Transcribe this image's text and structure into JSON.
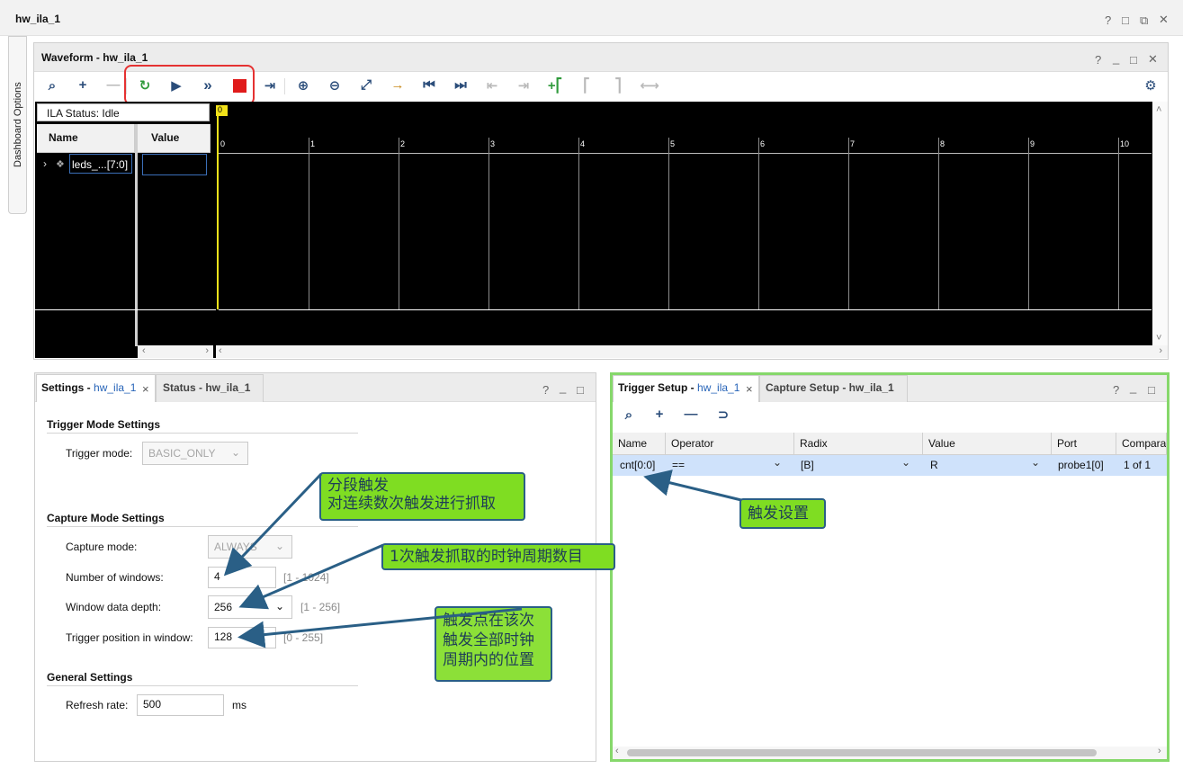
{
  "window": {
    "title": "hw_ila_1",
    "controls": [
      "?",
      "□",
      "⧉",
      "✕"
    ]
  },
  "sidebar": {
    "label": "Dashboard Options"
  },
  "waveform": {
    "title": "Waveform - hw_ila_1",
    "controls": [
      "?",
      "_",
      "□",
      "✕"
    ],
    "status": "ILA Status: Idle",
    "col_name": "Name",
    "col_value": "Value",
    "signal": "leds_...[7:0]",
    "cursor_label": "0",
    "ticks": [
      "0",
      "1",
      "2",
      "3",
      "4",
      "5",
      "6",
      "7",
      "8",
      "9",
      "10"
    ],
    "toolbar": [
      "search-icon",
      "add-icon",
      "remove-icon",
      "run-trigger-immediate-icon",
      "run-trigger-icon",
      "auto-rearm-icon",
      "stop-icon",
      "export-icon",
      "zoom-in-icon",
      "zoom-out-icon",
      "zoom-fit-icon",
      "go-to-cursor-icon",
      "go-to-start-icon",
      "go-to-end-icon",
      "prev-transition-icon",
      "next-transition-icon",
      "add-marker-icon",
      "prev-marker-icon",
      "next-marker-icon",
      "swap-markers-icon",
      "gear-icon"
    ],
    "highlight_color": "#e53232"
  },
  "settings": {
    "tab_label": "Settings - ",
    "tab_link": "hw_ila_1",
    "tab2_label": "Status - hw_ila_1",
    "controls": [
      "?",
      "_",
      "□"
    ],
    "trigger_section": "Trigger Mode Settings",
    "trigger_mode_label": "Trigger mode:",
    "trigger_mode_value": "BASIC_ONLY",
    "capture_section": "Capture Mode Settings",
    "capture_mode_label": "Capture mode:",
    "capture_mode_value": "ALWAYS",
    "windows_label": "Number of windows:",
    "windows_value": "4",
    "windows_hint": "[1 - 1024]",
    "depth_label": "Window data depth:",
    "depth_value": "256",
    "depth_hint": "[1 - 256]",
    "trigpos_label": "Trigger position in window:",
    "trigpos_value": "128",
    "trigpos_hint": "[0 - 255]",
    "general_section": "General Settings",
    "refresh_label": "Refresh rate:",
    "refresh_value": "500",
    "refresh_unit": "ms"
  },
  "trigger_setup": {
    "tab_label": "Trigger Setup - ",
    "tab_link": "hw_ila_1",
    "tab2_label": "Capture Setup - hw_ila_1",
    "controls": [
      "?",
      "_",
      "□"
    ],
    "columns": [
      "Name",
      "Operator",
      "Radix",
      "Value",
      "Port",
      "Compara"
    ],
    "row": [
      "cnt[0:0]",
      "==",
      "[B]",
      "R",
      "probe1[0]",
      "1 of 1"
    ],
    "border_color": "#86d86b"
  },
  "annotations": {
    "note1_line1": "分段触发",
    "note1_line2": "对连续数次触发进行抓取",
    "note2": "1次触发抓取的时钟周期数目",
    "note3_line1": "触发点在该次",
    "note3_line2": "触发全部时钟",
    "note3_line3": "周期内的位置",
    "note4": "触发设置"
  }
}
